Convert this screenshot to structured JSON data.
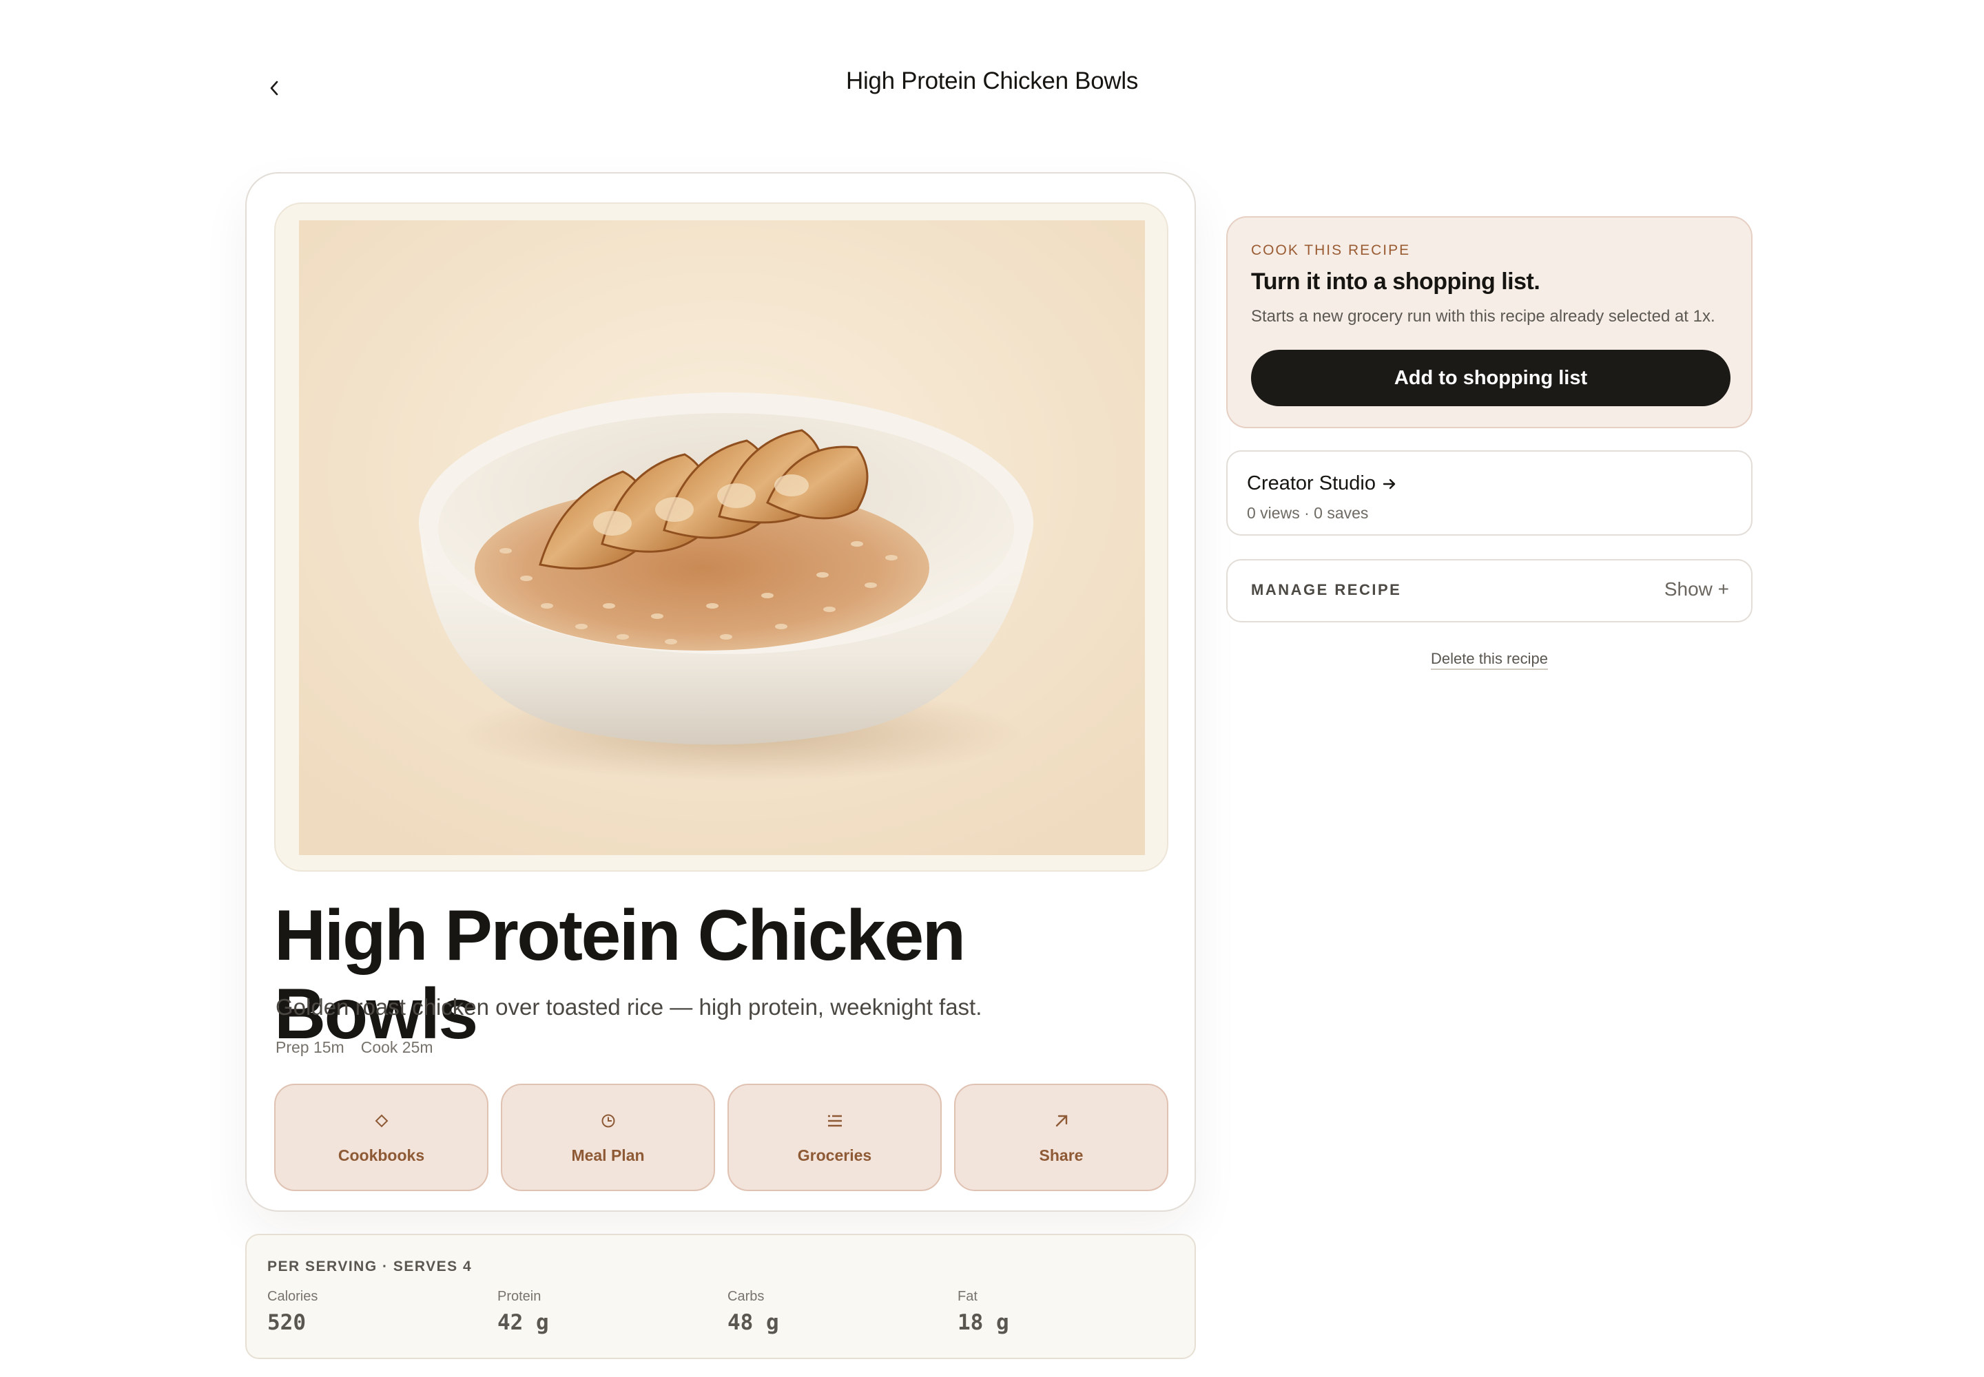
{
  "header": {
    "title": "High Protein Chicken Bowls",
    "back_icon": "chevron-left-icon"
  },
  "recipe": {
    "title": "High Protein Chicken Bowls",
    "subtitle": "Golden roast chicken over toasted rice — high protein, weeknight fast.",
    "prep": "Prep 15m",
    "cook": "Cook 25m",
    "actions": [
      {
        "label": "Cookbooks",
        "icon": "diamond-icon"
      },
      {
        "label": "Meal Plan",
        "icon": "clock-icon"
      },
      {
        "label": "Groceries",
        "icon": "list-icon"
      },
      {
        "label": "Share",
        "icon": "arrow-up-right-icon"
      }
    ]
  },
  "nutrition": {
    "heading": "PER SERVING · SERVES 4",
    "items": [
      {
        "label": "Calories",
        "value": "520"
      },
      {
        "label": "Protein",
        "value": "42 g"
      },
      {
        "label": "Carbs",
        "value": "48 g"
      },
      {
        "label": "Fat",
        "value": "18 g"
      }
    ]
  },
  "cook_card": {
    "eyebrow": "COOK THIS RECIPE",
    "headline": "Turn it into a shopping list.",
    "description": "Starts a new grocery run with this recipe already selected at 1x.",
    "button_label": "Add to shopping list"
  },
  "creator": {
    "title": "Creator Studio",
    "stats": "0 views · 0 saves"
  },
  "manage": {
    "title": "MANAGE RECIPE",
    "toggle": "Show +"
  },
  "delete_label": "Delete this recipe",
  "colors": {
    "accent": "#8e5a35",
    "action_bg": "#f2e3db",
    "cook_card_bg": "#f7ede7",
    "primary_button": "#1c1a16"
  }
}
